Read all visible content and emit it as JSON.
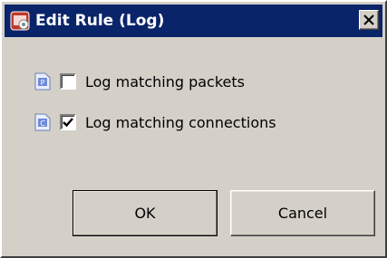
{
  "dialog": {
    "title": "Edit Rule (Log)",
    "close_glyph": "✕"
  },
  "options": [
    {
      "icon": "packet-icon",
      "icon_letter": "P",
      "label": "Log matching packets",
      "checked": false
    },
    {
      "icon": "connection-icon",
      "icon_letter": "C",
      "label": "Log matching connections",
      "checked": true
    }
  ],
  "buttons": {
    "ok": "OK",
    "cancel": "Cancel"
  },
  "colors": {
    "title_bar": "#0a246a",
    "face": "#d4d0c8"
  }
}
